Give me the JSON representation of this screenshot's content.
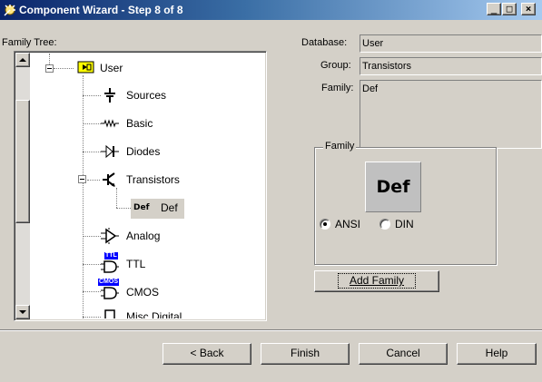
{
  "window": {
    "title": "Component Wizard - Step 8 of 8",
    "icon": "wizard-icon",
    "caption_buttons": [
      "_",
      "□",
      "×"
    ]
  },
  "left_panel": {
    "label": "Family Tree:",
    "tree": [
      {
        "label": "User",
        "icon": "user-folder-icon",
        "expanded": true
      },
      {
        "label": "Sources",
        "icon": "sources-icon"
      },
      {
        "label": "Basic",
        "icon": "resistor-icon"
      },
      {
        "label": "Diodes",
        "icon": "diode-icon"
      },
      {
        "label": "Transistors",
        "icon": "transistor-icon",
        "expanded": true
      },
      {
        "label": "Def",
        "icon": "def-family-icon",
        "icon_text": "Def",
        "selected": true
      },
      {
        "label": "Analog",
        "icon": "opamp-icon"
      },
      {
        "label": "TTL",
        "icon": "ttl-icon",
        "icon_text": "TTL"
      },
      {
        "label": "CMOS",
        "icon": "cmos-icon",
        "icon_text": "CMOS"
      },
      {
        "label": "Misc Digital",
        "icon": "misc-digital-icon"
      }
    ]
  },
  "info": {
    "database_label": "Database:",
    "database_value": "User",
    "group_label": "Group:",
    "group_value": "Transistors",
    "family_label": "Family:",
    "family_value": "Def"
  },
  "family_group": {
    "legend": "Family",
    "preview_text": "Def",
    "radio_ansi": "ANSI",
    "radio_din": "DIN",
    "selected": "ANSI",
    "add_family_button": "Add Family"
  },
  "footer": {
    "back_button": "< Back",
    "finish_button": "Finish",
    "cancel_button": "Cancel",
    "help_button": "Help"
  },
  "colors": {
    "title_bar_start": "#0a246a",
    "title_bar_end": "#a6caf0",
    "dialog_face": "#d4d0c8"
  }
}
